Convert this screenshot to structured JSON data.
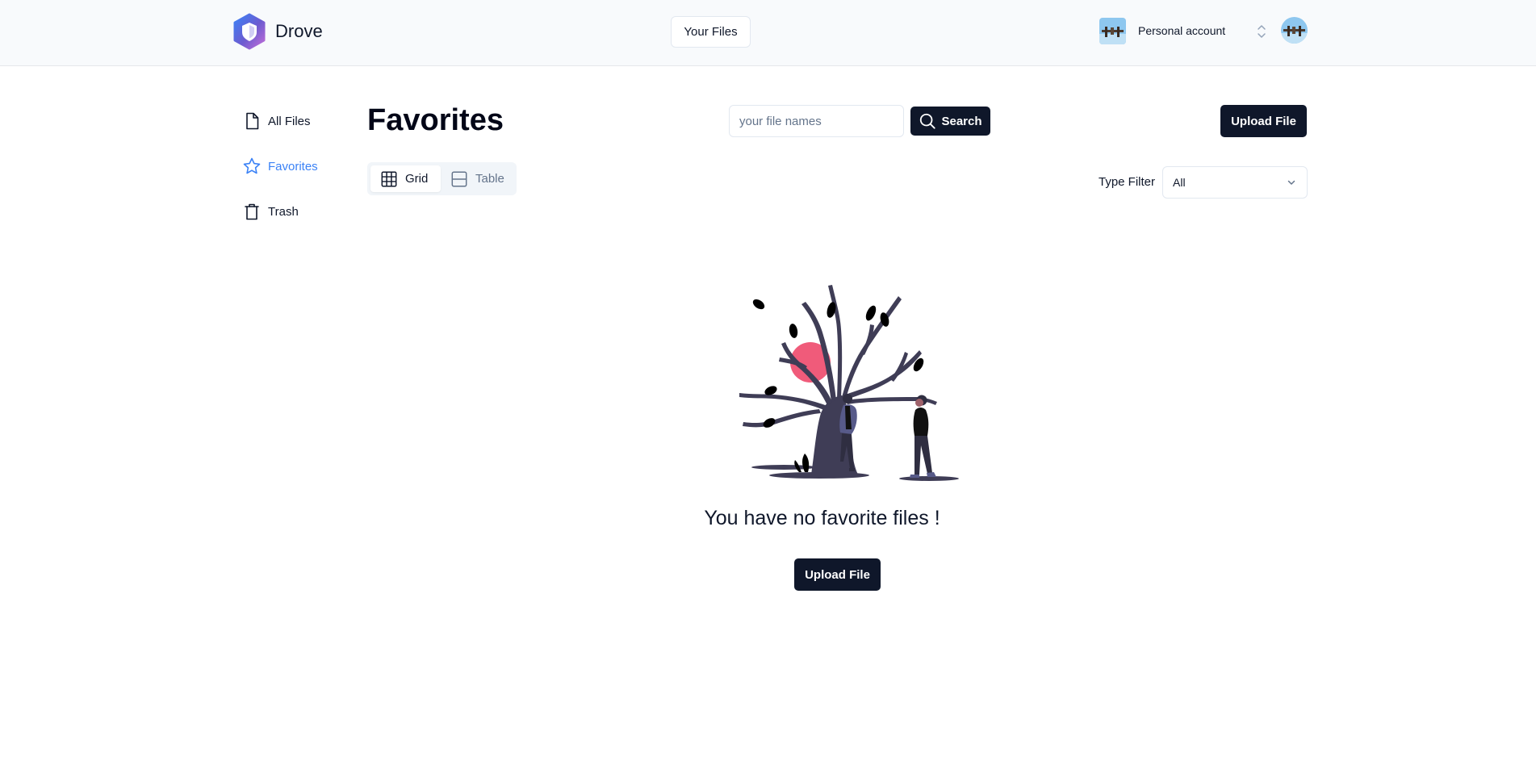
{
  "header": {
    "brand": "Drove",
    "your_files_label": "Your Files",
    "account_label": "Personal account"
  },
  "sidebar": {
    "items": [
      {
        "label": "All Files",
        "icon": "file-icon",
        "active": false
      },
      {
        "label": "Favorites",
        "icon": "star-icon",
        "active": true
      },
      {
        "label": "Trash",
        "icon": "trash-icon",
        "active": false
      }
    ]
  },
  "main": {
    "title": "Favorites",
    "search": {
      "placeholder": "your file names",
      "value": "",
      "button_label": "Search"
    },
    "upload_label": "Upload File",
    "view_toggle": {
      "grid_label": "Grid",
      "table_label": "Table",
      "selected": "Grid"
    },
    "type_filter": {
      "label": "Type Filter",
      "selected": "All"
    },
    "empty_state": {
      "message": "You have no favorite files !",
      "button_label": "Upload File"
    }
  },
  "colors": {
    "primary": "#0f172a",
    "accent_active": "#3b82f6",
    "header_bg": "#f8fafc",
    "illustration_tree": "#3f3d56",
    "illustration_sun": "#f05b7a"
  }
}
